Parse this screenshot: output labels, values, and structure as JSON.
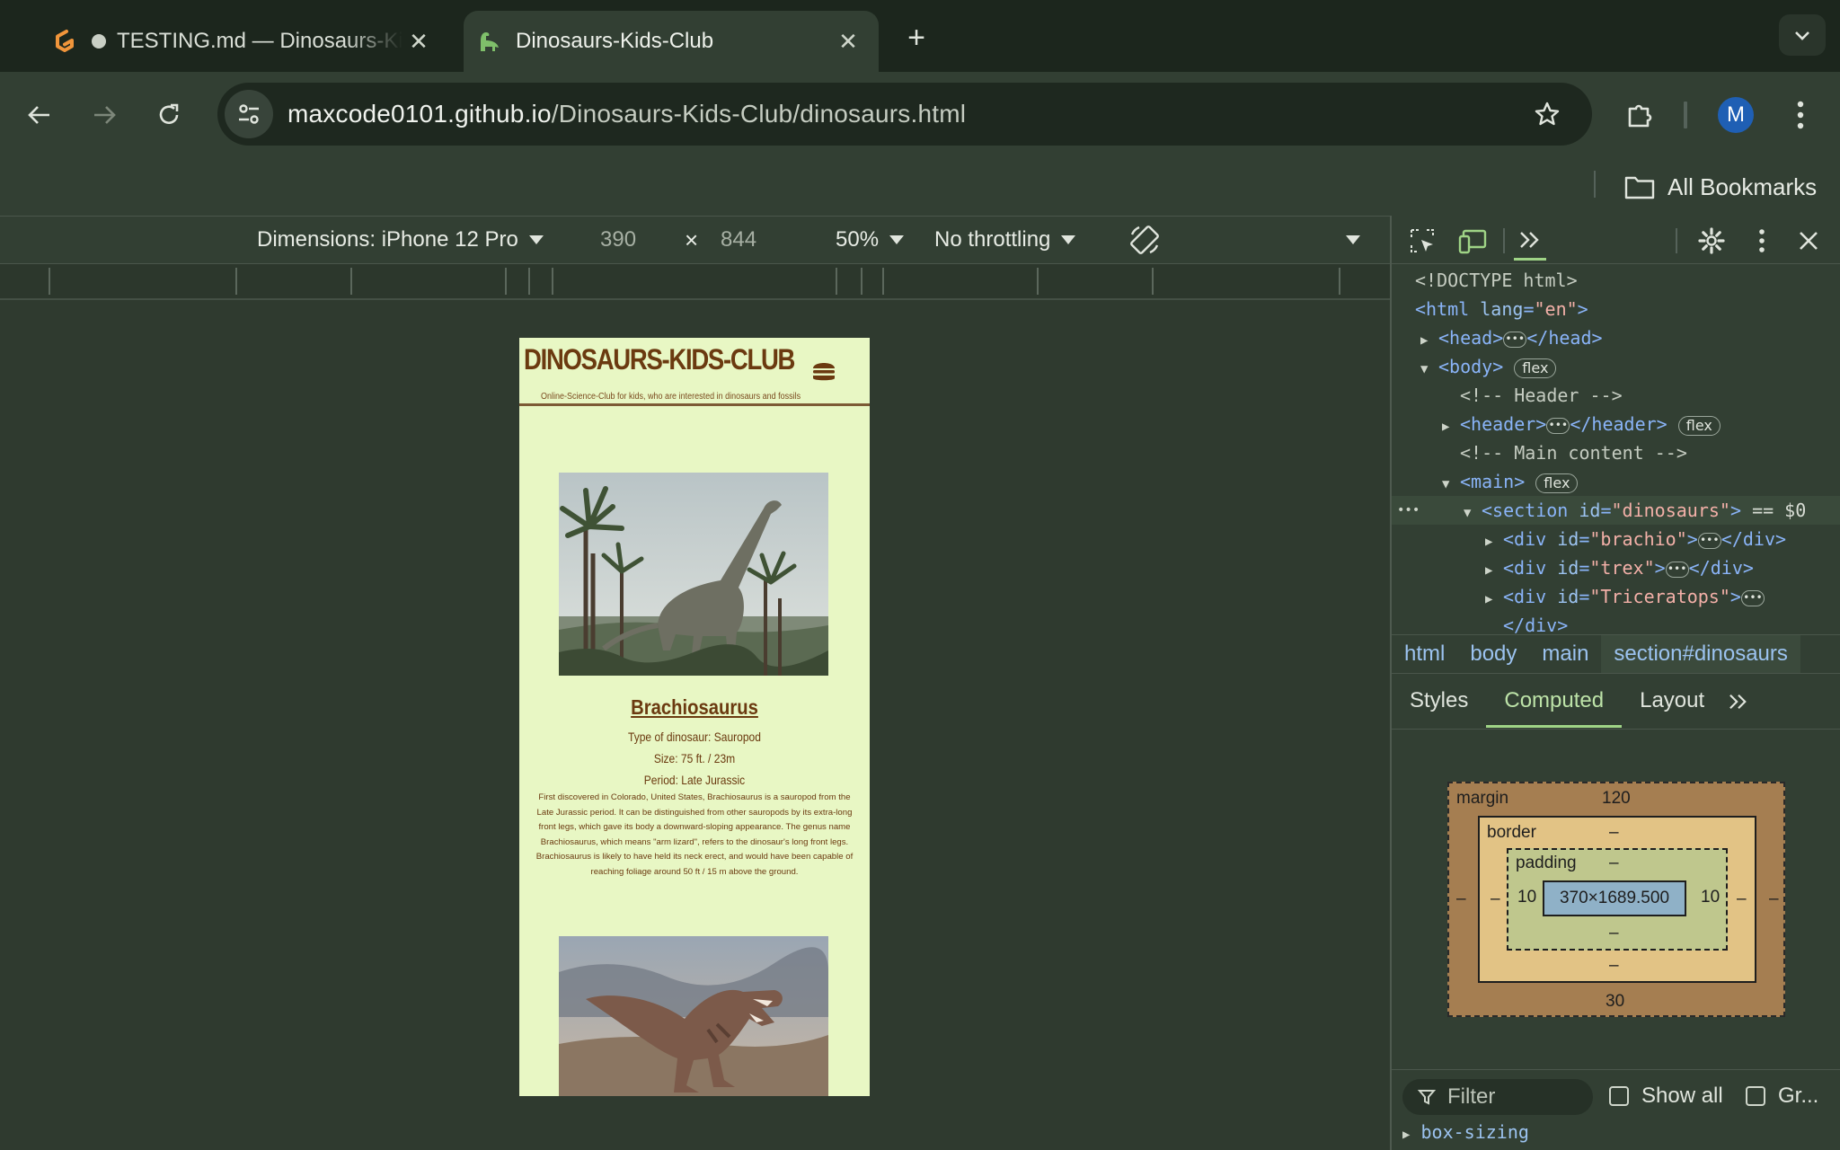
{
  "tabs": [
    {
      "title": "TESTING.md — Dinosaurs-Kids-Club",
      "icon": "gitpod-icon"
    },
    {
      "title": "Dinosaurs-Kids-Club",
      "icon": "dinosaur-icon"
    }
  ],
  "address_bar": {
    "host": "maxcode0101.github.io",
    "path": "/Dinosaurs-Kids-Club/dinosaurs.html"
  },
  "profile": {
    "initial": "M"
  },
  "bookmarks": {
    "all_label": "All Bookmarks"
  },
  "device_toolbar": {
    "dimensions_label": "Dimensions: iPhone 12 Pro",
    "width": "390",
    "times": "×",
    "height": "844",
    "zoom": "50%",
    "throttling": "No throttling"
  },
  "site": {
    "title": "DINOSAURS-KIDS-CLUB",
    "subtitle": "Online-Science-Club for kids, who are interested in dinosaurs and fossils",
    "dinosaurs": [
      {
        "name": "Brachiosaurus",
        "type": "Type of dinosaur: Sauropod",
        "size": "Size: 75 ft. / 23m",
        "period": "Period: Late Jurassic",
        "description": "First discovered in Colorado, United States, Brachiosaurus is a sauropod from the Late Jurassic period. It can be distinguished from other sauropods by its extra-long front legs, which gave its body a downward-sloping appearance. The genus name Brachiosaurus, which means \"arm lizard\", refers to the dinosaur's long front legs. Brachiosaurus is likely to have held its neck erect, and would have been capable of reaching foliage around 50 ft / 15 m above the ground."
      }
    ]
  },
  "devtools": {
    "elements": {
      "doctype": "<!DOCTYPE html>",
      "html_open": "<html",
      "lang_attr": "lang",
      "lang_val": "\"en\"",
      "head": "<head>",
      "head_close": "</head>",
      "body": "<body>",
      "flex": "flex",
      "comment_header": "<!-- Header -->",
      "header": "<header>",
      "header_close": "</header>",
      "comment_main": "<!-- Main content -->",
      "main": "<main>",
      "section": "<section",
      "id_attr": "id",
      "section_id": "\"dinosaurs\"",
      "section_close": ">",
      "selected_marker": "== $0",
      "div_open": "<div",
      "div_close": "</div>",
      "div_ids": [
        "\"brachio\"",
        "\"trex\"",
        "\"Triceratops\""
      ],
      "more": "•••"
    },
    "breadcrumbs": [
      "html",
      "body",
      "main",
      "section#dinosaurs"
    ],
    "sub_tabs": [
      "Styles",
      "Computed",
      "Layout"
    ],
    "active_sub_tab": "Computed",
    "box_model": {
      "margin_label": "margin",
      "margin_top": "120",
      "margin_bottom": "30",
      "margin_left": "–",
      "margin_right": "–",
      "border_label": "border",
      "border_value": "–",
      "padding_label": "padding",
      "padding_top": "–",
      "padding_bottom": "–",
      "padding_left": "10",
      "padding_right": "10",
      "content": "370×1689.500"
    },
    "filter_placeholder": "Filter",
    "show_all_label": "Show all",
    "group_label": "Gr...",
    "computed_property": "box-sizing"
  },
  "colors": {
    "site_background": "#e8f7c4",
    "site_text": "#6b3a10",
    "devtools_tag": "#8ab4f8",
    "devtools_attr_value": "#f3b0a8"
  }
}
